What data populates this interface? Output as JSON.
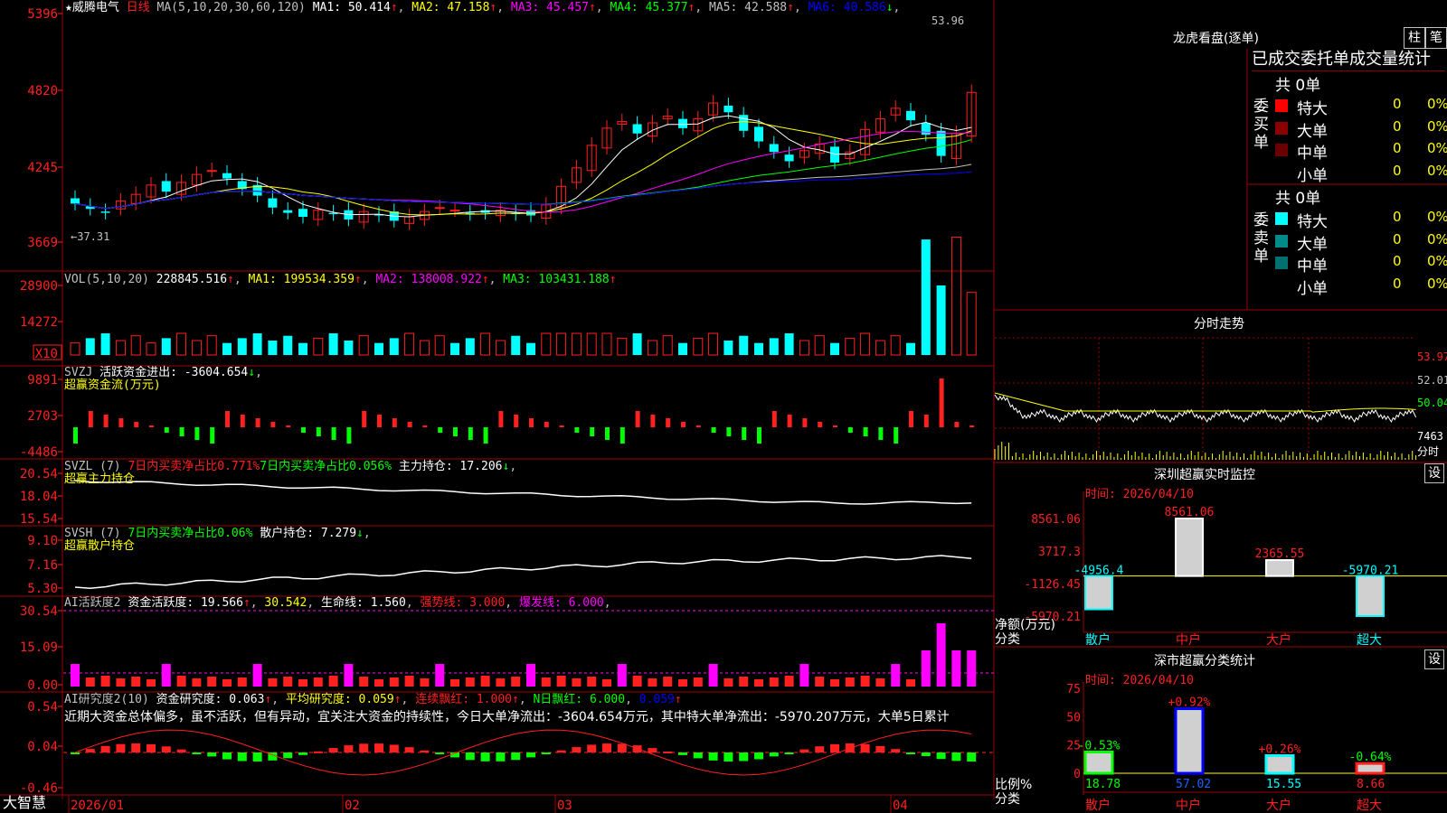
{
  "header": {
    "star": "★",
    "name": "威腾电气",
    "period": "日线",
    "ma_label": "MA(5,10,20,30,60,120)",
    "ma": [
      {
        "t": "MA1: 50.414",
        "a": "↑",
        "c": "#ffffff"
      },
      {
        "t": "MA2: 47.158",
        "a": "↑",
        "c": "#ffff00"
      },
      {
        "t": "MA3: 45.457",
        "a": "↑",
        "c": "#ff00ff"
      },
      {
        "t": "MA4: 45.377",
        "a": "↑",
        "c": "#00ff00"
      },
      {
        "t": "MA5: 42.588",
        "a": "↑",
        "c": "#c0c0c0"
      },
      {
        "t": "MA6: 40.586",
        "a": "↓",
        "c": "#0000ff"
      }
    ],
    "high_mark": "53.96",
    "low_mark": "←37.31"
  },
  "price_axis": [
    "5396",
    "4820",
    "4245",
    "3669"
  ],
  "vol": {
    "axis": [
      "28900",
      "14272",
      "X10"
    ],
    "label": "VOL(5,10,20)",
    "v": "228845.516",
    "ma1": "MA1: 199534.359",
    "ma2": "MA2: 138008.922",
    "ma3": "MA3: 103431.188",
    "up": "↑"
  },
  "svzj": {
    "axis": [
      "9891",
      "2703",
      "-4486"
    ],
    "label": "SVZJ",
    "desc": "活跃资金进出: -3604.654",
    "arrow": "↓",
    "sub": "超赢资金流(万元)"
  },
  "svzl": {
    "axis": [
      "20.54",
      "18.04",
      "15.54"
    ],
    "label": "SVZL (7)",
    "a": "7日内买卖净占比0.771%",
    "b": "7日内买卖净占比0.056%",
    "c": "主力持仓: 17.206",
    "arrow": "↓",
    "sub": "超赢主力持仓"
  },
  "svsh": {
    "axis": [
      "9.10",
      "7.16",
      "5.30"
    ],
    "label": "SVSH (7)",
    "a": "7日内买卖净占比0.06%",
    "b": "散户持仓: 7.279",
    "arrow": "↓",
    "sub": "超赢散户持仓"
  },
  "ai1": {
    "axis": [
      "30.54",
      "15.09",
      "0.00"
    ],
    "label": "AI活跃度2",
    "a": "资金活跃度: 19.566",
    "b": "30.542",
    "c": "生命线: 1.560",
    "d": "强势线: 3.000",
    "e": "爆发线: 6.000"
  },
  "ai2": {
    "axis": [
      "0.54",
      "0.04",
      "-0.46"
    ],
    "label": "AI研究度2(10)",
    "a": "资金研究度: 0.063",
    "b": "平均研究度: 0.059",
    "c": "连续飘红: 1.000",
    "d": "N日飘红: 6.000",
    "e": "0.059",
    "comment": "近期大资金总体偏多，虽不活跃，但有异动，宜关注大资金的持续性，今日大单净流出：-3604.654万元，其中特大单净流出：-5970.207万元，大单5日累计"
  },
  "dates": [
    "2026/01",
    "02",
    "03",
    "04"
  ],
  "brand": "大智慧",
  "dragon": {
    "title": "龙虎看盘(逐单)",
    "btn1": "柱",
    "btn2": "笔",
    "tab": "已成交委托单成交量统计",
    "buy_label": "委买单",
    "sell_label": "委卖单",
    "buy_total": "共 0单",
    "sell_total": "共 0单",
    "buy_rows": [
      {
        "n": "特大",
        "v": "0",
        "p": "0%",
        "c": "#ff0000"
      },
      {
        "n": "大单",
        "v": "0",
        "p": "0%",
        "c": "#8b0000"
      },
      {
        "n": "中单",
        "v": "0",
        "p": "0%",
        "c": "#6b0000"
      },
      {
        "n": "小单",
        "v": "0",
        "p": "0%",
        "c": ""
      }
    ],
    "sell_rows": [
      {
        "n": "特大",
        "v": "0",
        "p": "0%",
        "c": "#00ffff"
      },
      {
        "n": "大单",
        "v": "0",
        "p": "0%",
        "c": "#008b8b"
      },
      {
        "n": "中单",
        "v": "0",
        "p": "0%",
        "c": "#007070"
      },
      {
        "n": "小单",
        "v": "0",
        "p": "0%",
        "c": ""
      }
    ]
  },
  "intraday": {
    "title": "分时走势",
    "labels": [
      "53.97",
      "52.01",
      "50.04",
      "7463",
      "分时"
    ]
  },
  "monitor": {
    "title": "深圳超赢实时监控",
    "btn": "设",
    "time": "时间: 2026/04/10",
    "ylabel": "净额(万元)",
    "xlabel": "分类",
    "yticks": [
      "8561.06",
      "3717.3",
      "-1126.45",
      "-5970.21"
    ]
  },
  "stats": {
    "title": "深市超赢分类统计",
    "btn": "设",
    "time": "时间: 2026/04/10",
    "ylabel": "比例%",
    "xlabel": "分类",
    "yticks": [
      "75",
      "50",
      "25",
      "0"
    ]
  },
  "chart_data": [
    {
      "type": "bar",
      "title": "深圳超赢实时监控",
      "categories": [
        "散户",
        "中户",
        "大户",
        "超大"
      ],
      "values": [
        -4956.4,
        8561.06,
        2365.55,
        -5970.21
      ],
      "value_labels": [
        "-4956.4",
        "8561.06",
        "2365.55",
        "-5970.21"
      ],
      "ylim": [
        -5970.21,
        8561.06
      ],
      "ylabel": "净额(万元)",
      "xlabel": "分类"
    },
    {
      "type": "bar",
      "title": "深市超赢分类统计",
      "categories": [
        "散户",
        "中户",
        "大户",
        "超大"
      ],
      "values": [
        18.78,
        57.02,
        15.55,
        8.66
      ],
      "changes": [
        "-0.53%",
        "+0.92%",
        "+0.26%",
        "-0.64%"
      ],
      "ylim": [
        0,
        75
      ],
      "ylabel": "比例%",
      "xlabel": "分类"
    }
  ]
}
